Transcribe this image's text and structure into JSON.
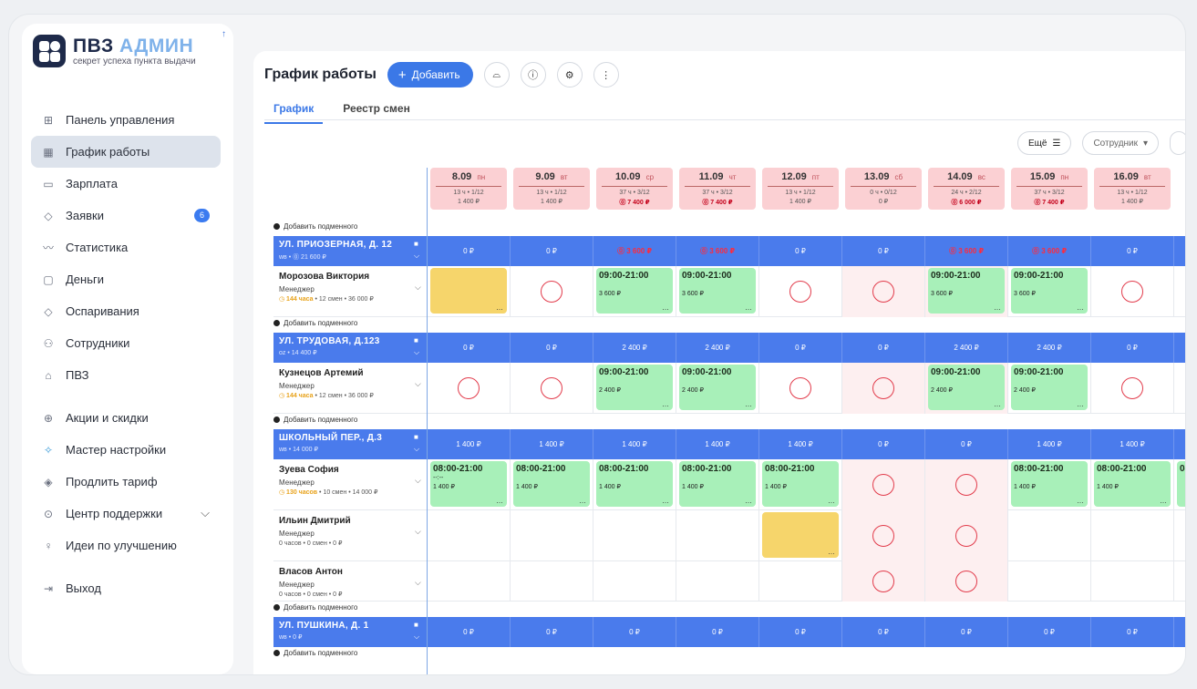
{
  "logo": {
    "title_a": "ПВЗ",
    "title_b": "АДМИН",
    "subtitle": "секрет успеха пункта выдачи"
  },
  "sidebar": {
    "items": [
      {
        "label": "Панель управления",
        "icon": "grid-icon",
        "glyph": "⊞"
      },
      {
        "label": "График работы",
        "icon": "calendar-icon",
        "glyph": "▦",
        "active": true
      },
      {
        "label": "Зарплата",
        "icon": "card-icon",
        "glyph": "▭"
      },
      {
        "label": "Заявки",
        "icon": "tag-icon",
        "glyph": "◇",
        "badge": "6"
      },
      {
        "label": "Статистика",
        "icon": "chart-line-icon",
        "glyph": "〰"
      },
      {
        "label": "Деньги",
        "icon": "wallet-icon",
        "glyph": "▢"
      },
      {
        "label": "Оспаривания",
        "icon": "dispute-icon",
        "glyph": "◇"
      },
      {
        "label": "Сотрудники",
        "icon": "users-icon",
        "glyph": "⚇"
      },
      {
        "label": "ПВЗ",
        "icon": "home-icon",
        "glyph": "⌂"
      },
      {
        "label": "Акции и скидки",
        "icon": "gift-icon",
        "glyph": "⊕"
      },
      {
        "label": "Мастер настройки",
        "icon": "wand-icon",
        "glyph": "✧",
        "highlight": true
      },
      {
        "label": "Продлить тариф",
        "icon": "diamond-icon",
        "glyph": "◈"
      },
      {
        "label": "Центр поддержки",
        "icon": "help-icon",
        "glyph": "⊙",
        "chevron": true
      },
      {
        "label": "Идеи по улучшению",
        "icon": "bulb-icon",
        "glyph": "♀"
      },
      {
        "label": "Выход",
        "icon": "logout-icon",
        "glyph": "⇥"
      }
    ]
  },
  "header": {
    "title": "График работы",
    "add_label": "Добавить"
  },
  "tabs": [
    {
      "label": "График",
      "active": true
    },
    {
      "label": "Реестр смен"
    }
  ],
  "filters": {
    "more": "Ещё",
    "employee": "Сотрудник"
  },
  "days": [
    {
      "date": "8.09",
      "dow": "пн",
      "hours": "13 ч • 1/12",
      "sum": "1 400 ₽",
      "red": false
    },
    {
      "date": "9.09",
      "dow": "вт",
      "hours": "13 ч • 1/12",
      "sum": "1 400 ₽",
      "red": false
    },
    {
      "date": "10.09",
      "dow": "ср",
      "hours": "37 ч • 3/12",
      "sum": "⓪ 7 400 ₽",
      "red": true
    },
    {
      "date": "11.09",
      "dow": "чт",
      "hours": "37 ч • 3/12",
      "sum": "⓪ 7 400 ₽",
      "red": true
    },
    {
      "date": "12.09",
      "dow": "пт",
      "hours": "13 ч • 1/12",
      "sum": "1 400 ₽",
      "red": false
    },
    {
      "date": "13.09",
      "dow": "сб",
      "hours": "0 ч • 0/12",
      "sum": "0 ₽",
      "red": false
    },
    {
      "date": "14.09",
      "dow": "вс",
      "hours": "24 ч • 2/12",
      "sum": "⓪ 6 000 ₽",
      "red": true
    },
    {
      "date": "15.09",
      "dow": "пн",
      "hours": "37 ч • 3/12",
      "sum": "⓪ 7 400 ₽",
      "red": true
    },
    {
      "date": "16.09",
      "dow": "вт",
      "hours": "13 ч • 1/12",
      "sum": "1 400 ₽",
      "red": false
    }
  ],
  "add_sub_label": "Добавить подменного",
  "points": [
    {
      "name": "УЛ. ПРИОЗЕРНАЯ, Д. 12",
      "sub": "wв • ⓪ 21 600 ₽",
      "totals": [
        [
          "0 ₽",
          false
        ],
        [
          "0 ₽",
          false
        ],
        [
          "⓪ 3 600 ₽",
          true
        ],
        [
          "⓪ 3 600 ₽",
          true
        ],
        [
          "0 ₽",
          false
        ],
        [
          "0 ₽",
          false
        ],
        [
          "⓪ 3 600 ₽",
          true
        ],
        [
          "⓪ 3 600 ₽",
          true
        ],
        [
          "0 ₽",
          false
        ]
      ],
      "employees": [
        {
          "name": "Морозова Виктория",
          "role": "Менеджер",
          "hours": "144 часа",
          "stat": " • 12 смен • 36 000 ₽",
          "cells": [
            {
              "t": "yellow"
            },
            {
              "t": "circle"
            },
            {
              "t": "shift",
              "time": "09:00-21:00",
              "price": "3 600 ₽"
            },
            {
              "t": "shift",
              "time": "09:00-21:00",
              "price": "3 600 ₽"
            },
            {
              "t": "circle"
            },
            {
              "t": "circle",
              "wk": true
            },
            {
              "t": "shift",
              "time": "09:00-21:00",
              "price": "3 600 ₽",
              "wk": true
            },
            {
              "t": "shift",
              "time": "09:00-21:00",
              "price": "3 600 ₽"
            },
            {
              "t": "circle"
            }
          ]
        }
      ]
    },
    {
      "name": "УЛ. ТРУДОВАЯ, Д.123",
      "sub": "oz • 14 400 ₽",
      "totals": [
        [
          "0 ₽",
          false
        ],
        [
          "0 ₽",
          false
        ],
        [
          "2 400 ₽",
          false
        ],
        [
          "2 400 ₽",
          false
        ],
        [
          "0 ₽",
          false
        ],
        [
          "0 ₽",
          false
        ],
        [
          "2 400 ₽",
          false
        ],
        [
          "2 400 ₽",
          false
        ],
        [
          "0 ₽",
          false
        ]
      ],
      "employees": [
        {
          "name": "Кузнецов Артемий",
          "role": "Менеджер",
          "hours": "144 часа",
          "stat": " • 12 смен • 36 000 ₽",
          "cells": [
            {
              "t": "circle"
            },
            {
              "t": "circle"
            },
            {
              "t": "shift",
              "time": "09:00-21:00",
              "price": "2 400 ₽"
            },
            {
              "t": "shift",
              "time": "09:00-21:00",
              "price": "2 400 ₽"
            },
            {
              "t": "circle"
            },
            {
              "t": "circle",
              "wk": true
            },
            {
              "t": "shift",
              "time": "09:00-21:00",
              "price": "2 400 ₽",
              "wk": true
            },
            {
              "t": "shift",
              "time": "09:00-21:00",
              "price": "2 400 ₽"
            },
            {
              "t": "circle"
            }
          ]
        }
      ]
    },
    {
      "name": "ШКОЛЬНЫЙ ПЕР., Д.3",
      "sub": "wв • 14 000 ₽",
      "totals": [
        [
          "1 400 ₽",
          false
        ],
        [
          "1 400 ₽",
          false
        ],
        [
          "1 400 ₽",
          false
        ],
        [
          "1 400 ₽",
          false
        ],
        [
          "1 400 ₽",
          false
        ],
        [
          "0 ₽",
          false
        ],
        [
          "0 ₽",
          false
        ],
        [
          "1 400 ₽",
          false
        ],
        [
          "1 400 ₽",
          false
        ]
      ],
      "employees": [
        {
          "name": "Зуева София",
          "role": "Менеджер",
          "hours": "130 часов",
          "stat": " • 10 смен • 14 000 ₽",
          "cells": [
            {
              "t": "shift",
              "time": "08:00-21:00",
              "price": "1 400 ₽",
              "note": "--:--"
            },
            {
              "t": "shift",
              "time": "08:00-21:00",
              "price": "1 400 ₽"
            },
            {
              "t": "shift",
              "time": "08:00-21:00",
              "price": "1 400 ₽"
            },
            {
              "t": "shift",
              "time": "08:00-21:00",
              "price": "1 400 ₽"
            },
            {
              "t": "shift",
              "time": "08:00-21:00",
              "price": "1 400 ₽"
            },
            {
              "t": "circle",
              "wk": true
            },
            {
              "t": "circle",
              "wk": true
            },
            {
              "t": "shift",
              "time": "08:00-21:00",
              "price": "1 400 ₽"
            },
            {
              "t": "shift",
              "time": "08:00-21:00",
              "price": "1 400 ₽"
            }
          ]
        },
        {
          "name": "Ильин Дмитрий",
          "role": "Менеджер",
          "hours": "",
          "stat": "0 часов • 0 смен • 0 ₽",
          "cells": [
            {
              "t": "empty"
            },
            {
              "t": "empty"
            },
            {
              "t": "empty"
            },
            {
              "t": "empty"
            },
            {
              "t": "yellow"
            },
            {
              "t": "circle",
              "wk": true
            },
            {
              "t": "circle",
              "wk": true
            },
            {
              "t": "empty"
            },
            {
              "t": "empty"
            }
          ]
        },
        {
          "name": "Власов Антон",
          "role": "Менеджер",
          "hours": "",
          "stat": "0 часов • 0 смен • 0 ₽",
          "cells": [
            {
              "t": "empty"
            },
            {
              "t": "empty"
            },
            {
              "t": "empty"
            },
            {
              "t": "empty"
            },
            {
              "t": "empty"
            },
            {
              "t": "circle",
              "wk": true
            },
            {
              "t": "circle",
              "wk": true
            },
            {
              "t": "empty"
            },
            {
              "t": "empty"
            }
          ]
        }
      ]
    },
    {
      "name": "УЛ. ПУШКИНА, Д. 1",
      "sub": "wв • 0 ₽",
      "totals": [
        [
          "0 ₽",
          false
        ],
        [
          "0 ₽",
          false
        ],
        [
          "0 ₽",
          false
        ],
        [
          "0 ₽",
          false
        ],
        [
          "0 ₽",
          false
        ],
        [
          "0 ₽",
          false
        ],
        [
          "0 ₽",
          false
        ],
        [
          "0 ₽",
          false
        ],
        [
          "0 ₽",
          false
        ]
      ],
      "employees": []
    }
  ]
}
